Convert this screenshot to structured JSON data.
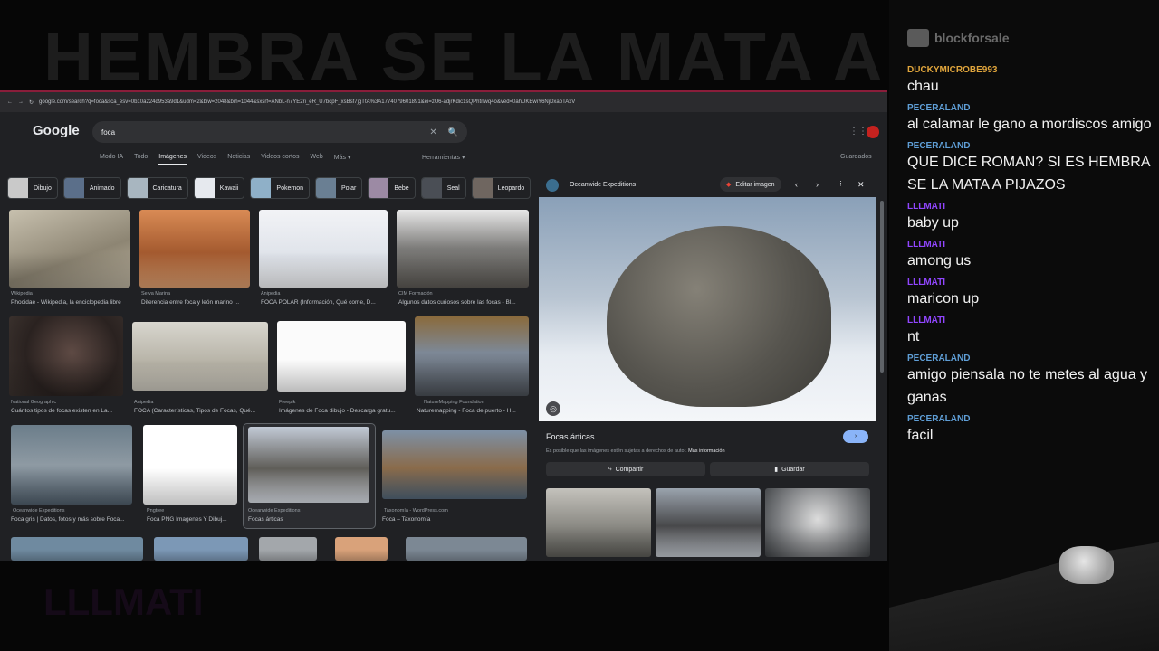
{
  "overlay": {
    "banner_top": "HEMBRA SE LA MATA A P",
    "banner_bottom": "LLLMATI"
  },
  "browser": {
    "url": "google.com/search?q=foca&sca_esv=0b10a224d953a9d1&udm=2&biw=2048&bih=1044&sxsrf=ANbL-n7YE2ri_eR_U7bcpF_xsBsf7jgTtA%3A1774079601891&ei=zU6-adjrKdic1sQPhtnwq4o&ved=0ahUKEwiY6NjDxabTAxV",
    "logo": "Google",
    "search_value": "foca",
    "tabs": [
      "Modo IA",
      "Todo",
      "Imágenes",
      "Videos",
      "Noticias",
      "Videos cortos",
      "Web",
      "Más ▾"
    ],
    "tools": "Herramientas ▾",
    "saved": "Guardados"
  },
  "chips": [
    "Dibujo",
    "Animado",
    "Caricatura",
    "Kawaii",
    "Pokemon",
    "Polar",
    "Bebe",
    "Seal",
    "Leopardo"
  ],
  "results": [
    {
      "source": "Wikipedia",
      "caption": "Phocidae - Wikipedia, la enciclopedia libre"
    },
    {
      "source": "Selva Marina",
      "caption": "Diferencia entre foca y león marino ..."
    },
    {
      "source": "Anipedia",
      "caption": "FOCA POLAR (Información, Qué come, D..."
    },
    {
      "source": "CIM Formación",
      "caption": "Algunos datos curiosos sobre las focas - Bl..."
    },
    {
      "source": "National Geographic",
      "caption": "Cuántos tipos de focas existen en La..."
    },
    {
      "source": "Anipedia",
      "caption": "FOCA (Características, Tipos de Focas, Qué..."
    },
    {
      "source": "Freepik",
      "caption": "Imágenes de Foca dibujo - Descarga gratu..."
    },
    {
      "source": "NatureMapping Foundation",
      "caption": "Naturemapping - Foca de puerto - H..."
    },
    {
      "source": "Oceanwide Expeditions",
      "caption": "Foca gris | Datos, fotos y más sobre Foca..."
    },
    {
      "source": "Pngtree",
      "caption": "Foca PNG Imagenes Y Dibuj..."
    },
    {
      "source": "Oceanwide Expeditions",
      "caption": "Focas árticas"
    },
    {
      "source": "Taxonomía - WordPress.com",
      "caption": "Foca – Taxonomía"
    }
  ],
  "panel": {
    "source": "Oceanwide Expeditions",
    "edit_label": "Editar imagen",
    "title": "Focas árticas",
    "notice": "Es posible que las imágenes estén sujetas a derechos de autor.",
    "more_info": "Más información",
    "share": "Compartir",
    "save": "Guardar"
  },
  "chat": {
    "logo": "blockforsale",
    "messages": [
      {
        "user": "DUCKYMICROBE993",
        "color": "#e0a53c",
        "text": "chau"
      },
      {
        "user": "PECERALAND",
        "color": "#5f9ed6",
        "text": "al calamar le gano a mordiscos amigo"
      },
      {
        "user": "PECERALAND",
        "color": "#5f9ed6",
        "text": "QUE DICE ROMAN? SI ES HEMBRA SE LA MATA A PIJAZOS"
      },
      {
        "user": "LLLMATI",
        "color": "#9146ff",
        "text": "baby up"
      },
      {
        "user": "LLLMATI",
        "color": "#9146ff",
        "text": "among us"
      },
      {
        "user": "LLLMATI",
        "color": "#9146ff",
        "text": "maricon up"
      },
      {
        "user": "LLLMATI",
        "color": "#9146ff",
        "text": "nt"
      },
      {
        "user": "PECERALAND",
        "color": "#5f9ed6",
        "text": "amigo piensala no te metes al agua y ganas"
      },
      {
        "user": "PECERALAND",
        "color": "#5f9ed6",
        "text": "facil"
      }
    ]
  }
}
